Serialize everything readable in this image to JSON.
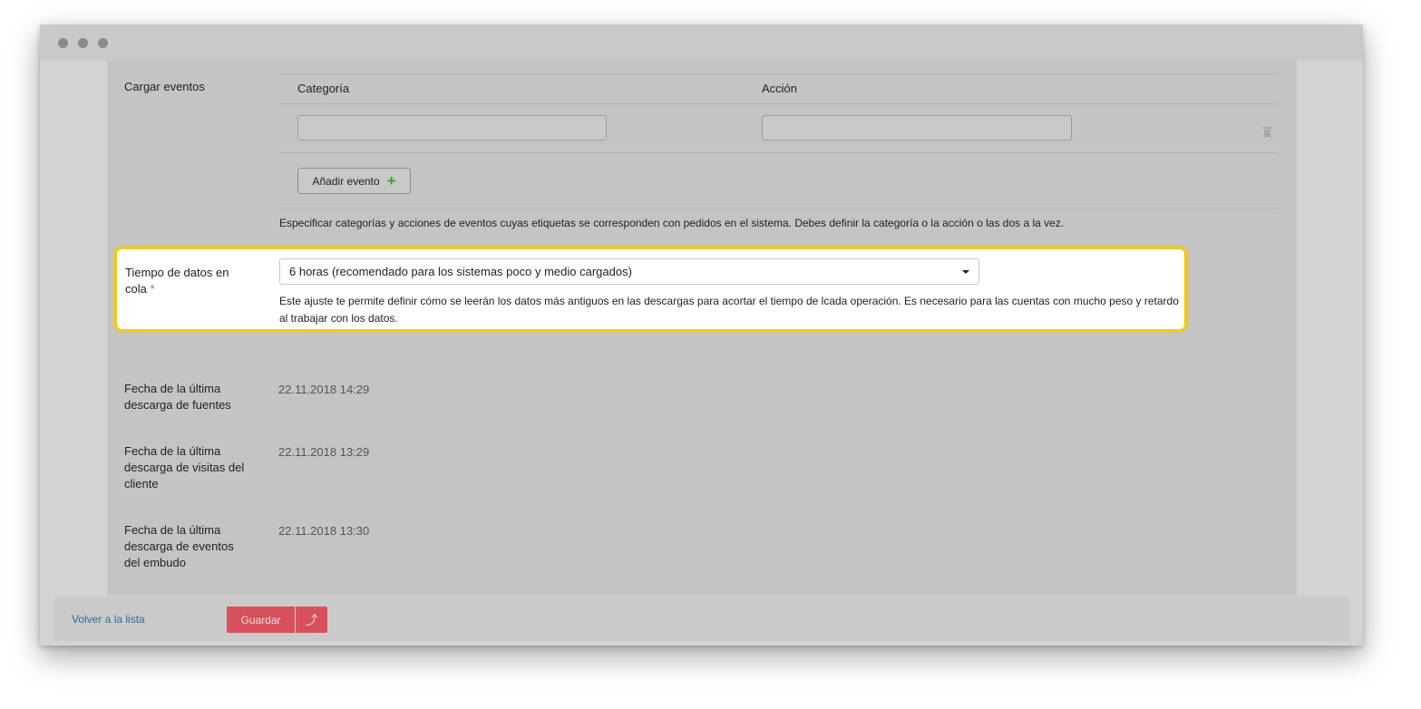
{
  "events": {
    "label": "Cargar eventos",
    "col_category": "Categoría",
    "col_action": "Acción",
    "category_value": "",
    "action_value": "",
    "add_button": "Añadir evento",
    "add_icon": "+",
    "help": "Especificar categorías y acciones de eventos cuyas etiquetas se corresponden con pedidos en el sistema. Debes definir la categoría o la acción o las dos a la vez."
  },
  "queue": {
    "label": "Tiempo de datos en cola",
    "required_mark": "*",
    "selected": "6 horas (recomendado para los sistemas poco y medio cargados)",
    "help": "Este ajuste te permite definir cómo se leerán los datos más antiguos en las descargas para acortar el tiempo de lcada operación. Es necesario para las cuentas con mucho peso y retardo al trabajar con los datos."
  },
  "stats": [
    {
      "label": "Fecha de la última descarga de fuentes",
      "value": "22.11.2018 14:29"
    },
    {
      "label": "Fecha de la última descarga de visitas del cliente",
      "value": "22.11.2018 13:29"
    },
    {
      "label": "Fecha de la última descarga de eventos del embudo",
      "value": "22.11.2018 13:30"
    }
  ],
  "footer": {
    "back_link": "Volver a la lista",
    "save_button": "Guardar",
    "save_up_icon": "⤴"
  },
  "colors": {
    "highlight_border": "#f5c912",
    "save_button": "#d6515b",
    "link": "#2a6f97",
    "required": "#d9534f"
  }
}
